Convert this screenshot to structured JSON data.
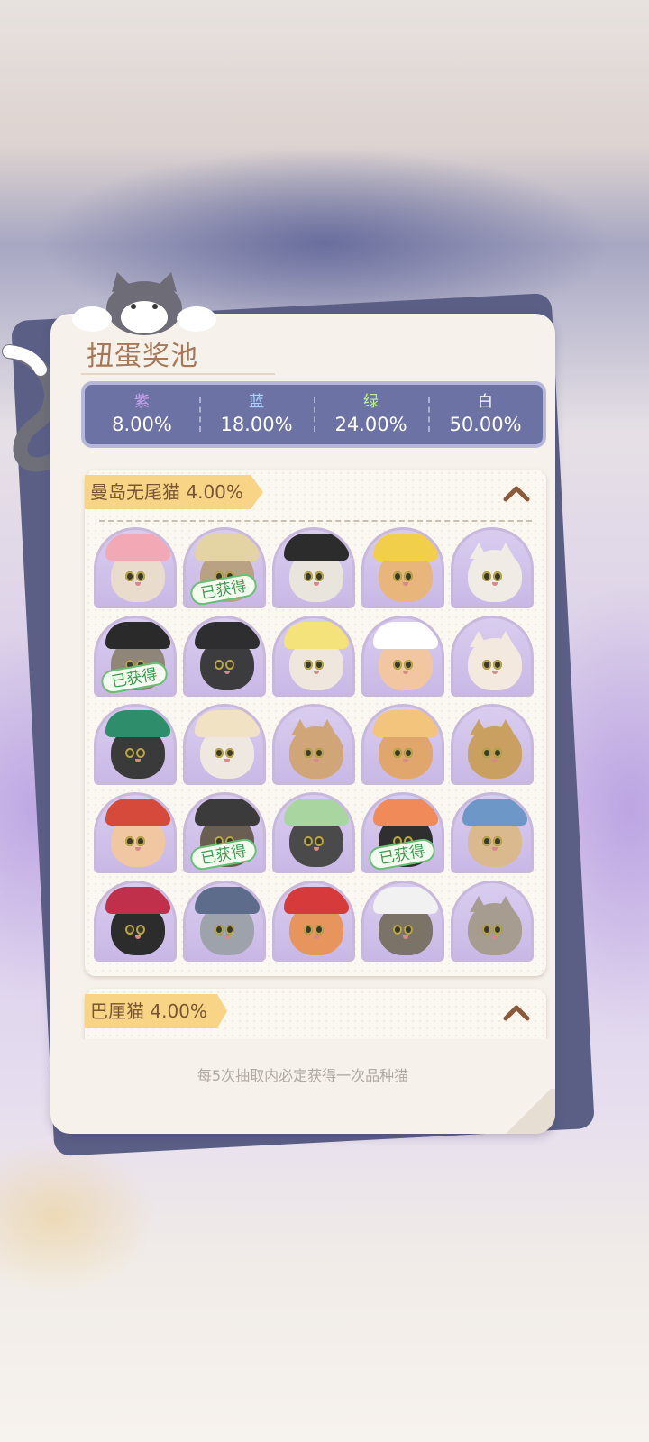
{
  "panel": {
    "title": "扭蛋奖池",
    "footer_note": "每5次抽取内必定获得一次品种猫"
  },
  "rarity_rates": [
    {
      "name": "紫",
      "value": "8.00%",
      "color": "#c9a3ee"
    },
    {
      "name": "蓝",
      "value": "18.00%",
      "color": "#a8d4ff"
    },
    {
      "name": "绿",
      "value": "24.00%",
      "color": "#b9ef9b"
    },
    {
      "name": "白",
      "value": "50.00%",
      "color": "#ffffff"
    }
  ],
  "obtained_label": "已获得",
  "sections": [
    {
      "label": "曼岛无尾猫 4.00%",
      "expanded": true,
      "items": [
        {
          "costume": "pink-bear-hood",
          "fur": "#e9dccd",
          "hat": "#f3a9b5",
          "obtained": false
        },
        {
          "costume": "straw-hat",
          "fur": "#b9a184",
          "hat": "#e4d3a3",
          "obtained": true
        },
        {
          "costume": "panda-hood",
          "fur": "#e9e4dc",
          "hat": "#2c2c2c",
          "obtained": false
        },
        {
          "costume": "chick-hood",
          "fur": "#e8b57a",
          "hat": "#f2cf4a",
          "obtained": false
        },
        {
          "costume": "plain-white",
          "fur": "#f1ebe6",
          "hat": "none",
          "obtained": false
        },
        {
          "costume": "pirate-hat",
          "fur": "#8f8578",
          "hat": "#2a2a2a",
          "obtained": true
        },
        {
          "costume": "black-paw-cap",
          "fur": "#3c3b3d",
          "hat": "#2e2e30",
          "obtained": false
        },
        {
          "costume": "yellow-bucket-hat",
          "fur": "#efe7de",
          "hat": "#f4e27a",
          "obtained": false
        },
        {
          "costume": "nurse-cap",
          "fur": "#f2c6a0",
          "hat": "#ffffff",
          "obtained": false
        },
        {
          "costume": "unicorn-horn",
          "fur": "#f3e9df",
          "hat": "none",
          "obtained": false
        },
        {
          "costume": "green-top-hat",
          "fur": "#3a3a3a",
          "hat": "#2e8d6a",
          "obtained": false
        },
        {
          "costume": "sun-hat",
          "fur": "#efe8e0",
          "hat": "#f1e2c4",
          "obtained": false
        },
        {
          "costume": "plain-tabby",
          "fur": "#d0a577",
          "hat": "none",
          "obtained": false
        },
        {
          "costume": "bread-toast",
          "fur": "#e1a66c",
          "hat": "#f3c47c",
          "obtained": false
        },
        {
          "costume": "pumpkin-clip",
          "fur": "#caa060",
          "hat": "none",
          "obtained": false
        },
        {
          "costume": "red-knit-hood",
          "fur": "#f0c7a0",
          "hat": "#d54a3a",
          "obtained": false
        },
        {
          "costume": "samurai-helmet",
          "fur": "#6a5d52",
          "hat": "#3b3b3b",
          "obtained": true
        },
        {
          "costume": "green-bonnet",
          "fur": "#4a4a4a",
          "hat": "#a9d6a0",
          "obtained": false
        },
        {
          "costume": "sushi-hat",
          "fur": "#2f2f30",
          "hat": "#f08a58",
          "obtained": true
        },
        {
          "costume": "shark-hood",
          "fur": "#d9b98d",
          "hat": "#6d97c7",
          "obtained": false
        },
        {
          "costume": "royal-crown",
          "fur": "#2c2c2c",
          "hat": "#c0304a",
          "obtained": false
        },
        {
          "costume": "headband-light",
          "fur": "#9ea3ab",
          "hat": "#5d6c8a",
          "obtained": false
        },
        {
          "costume": "santa-hat",
          "fur": "#e7955c",
          "hat": "#d63a3a",
          "obtained": false
        },
        {
          "costume": "chef-hat-ring",
          "fur": "#7b7268",
          "hat": "#f1f1f1",
          "obtained": false
        },
        {
          "costume": "bowtie-tabby",
          "fur": "#a69c90",
          "hat": "none",
          "obtained": false
        }
      ]
    },
    {
      "label": "巴厘猫 4.00%",
      "expanded": true,
      "items": []
    }
  ]
}
